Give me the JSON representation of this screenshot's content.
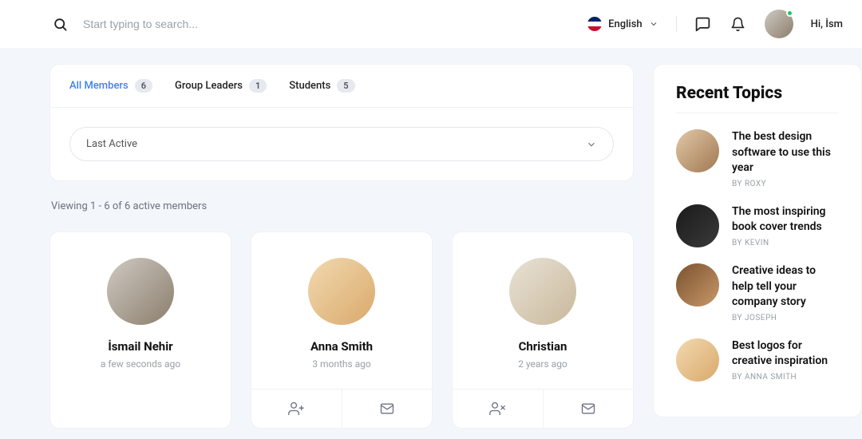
{
  "header": {
    "search_placeholder": "Start typing to search...",
    "language": "English",
    "greeting": "Hi,  İsm"
  },
  "tabs": [
    {
      "label": "All Members",
      "count": "6",
      "active": true
    },
    {
      "label": "Group Leaders",
      "count": "1",
      "active": false
    },
    {
      "label": "Students",
      "count": "5",
      "active": false
    }
  ],
  "sort": {
    "selected": "Last Active"
  },
  "viewing": "Viewing 1 - 6 of 6 active members",
  "members": [
    {
      "name": "İsmail Nehir",
      "time": "a few seconds ago",
      "actions": [
        "none",
        "none"
      ]
    },
    {
      "name": "Anna Smith",
      "time": "3 months ago",
      "actions": [
        "add",
        "mail"
      ]
    },
    {
      "name": "Christian",
      "time": "2 years ago",
      "actions": [
        "remove",
        "mail"
      ]
    }
  ],
  "sidebar": {
    "title": "Recent Topics",
    "topics": [
      {
        "title": "The best design software to use this year",
        "by": "BY ROXY"
      },
      {
        "title": "The most inspiring book cover trends",
        "by": "BY KEVIN"
      },
      {
        "title": "Creative ideas to help tell your company story",
        "by": "BY JOSEPH"
      },
      {
        "title": "Best logos for creative inspiration",
        "by": "BY ANNA SMITH"
      }
    ]
  }
}
